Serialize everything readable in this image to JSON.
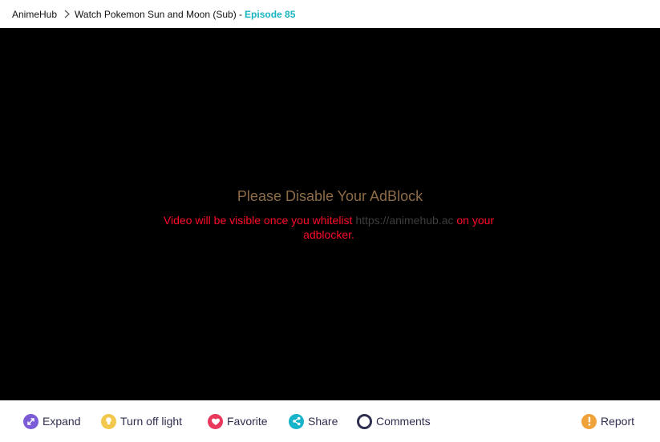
{
  "breadcrumb": {
    "home": "AnimeHub",
    "current": "Watch Pokemon Sun and Moon (Sub) - ",
    "episode": "Episode 85"
  },
  "player": {
    "notice_title": "Please Disable Your AdBlock",
    "notice_text_before": "Video will be visible once you whitelist ",
    "notice_url": "https://animehub.ac",
    "notice_text_after": " on your adblocker."
  },
  "toolbar": {
    "expand": "Expand",
    "light": "Turn off light",
    "favorite": "Favorite",
    "share": "Share",
    "comments": "Comments",
    "report": "Report"
  },
  "colors": {
    "episode_accent": "#16b4c0",
    "expand_icon": "#7b5cd6",
    "light_icon": "#f1c84b",
    "favorite_icon": "#e8385c",
    "share_icon": "#17b3c8",
    "comments_icon": "#2e2e4e",
    "report_icon": "#f0a23a",
    "notice_title": "#8d6b48",
    "notice_text": "#ff0b2a"
  },
  "icons": {
    "expand": "expand-icon",
    "light": "lightbulb-icon",
    "favorite": "heart-icon",
    "share": "share-icon",
    "comments": "comment-icon",
    "report": "alert-icon"
  }
}
